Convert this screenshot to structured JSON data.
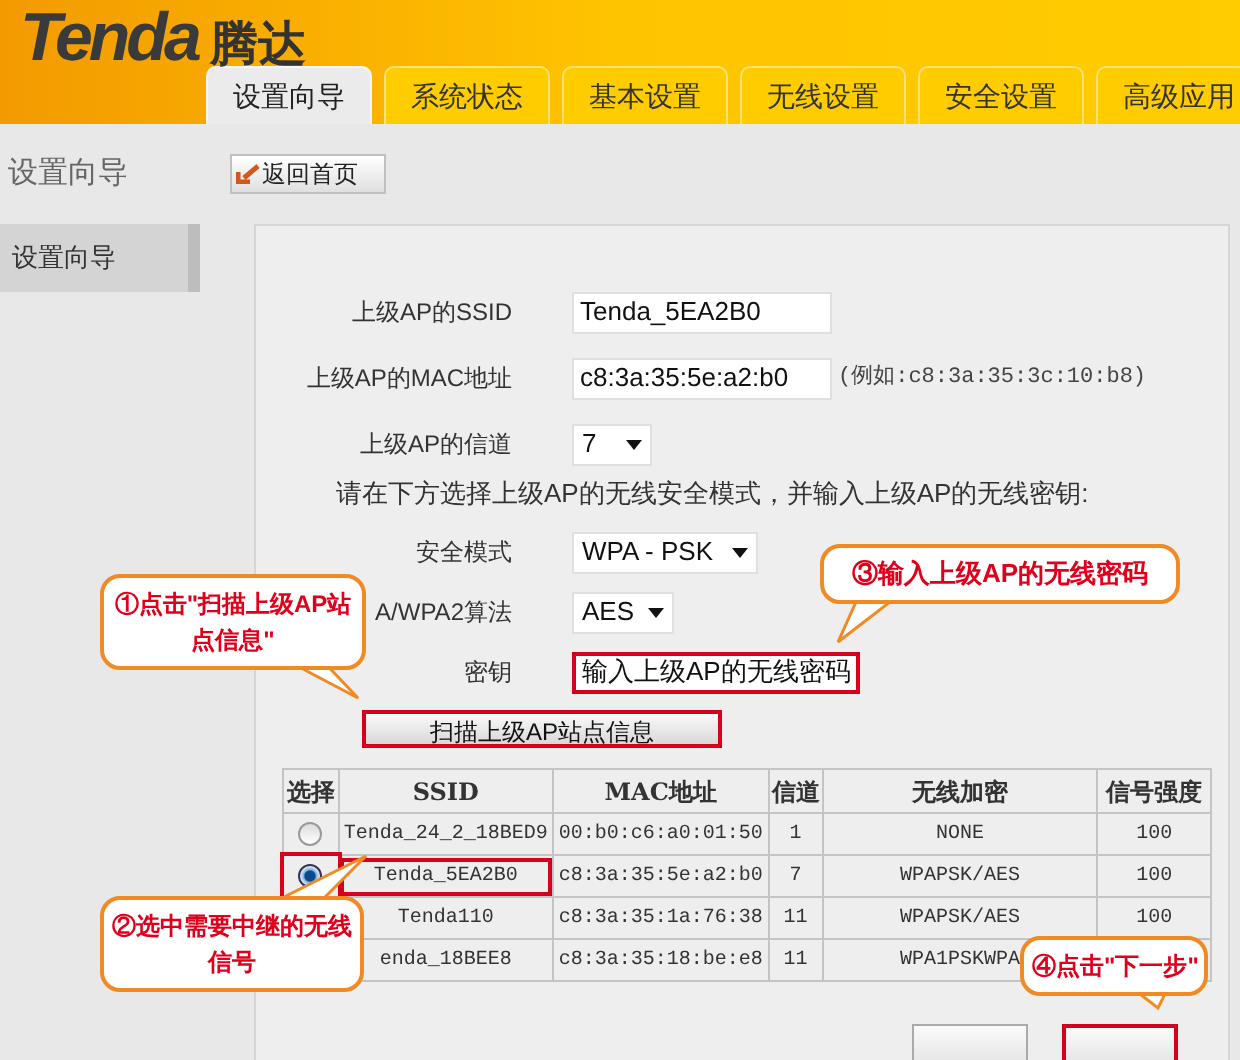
{
  "logo": {
    "wordmark": "Tenda",
    "chinese": "腾达"
  },
  "tabs": [
    {
      "label": "设置向导",
      "selected": true
    },
    {
      "label": "系统状态",
      "selected": false
    },
    {
      "label": "基本设置",
      "selected": false
    },
    {
      "label": "无线设置",
      "selected": false
    },
    {
      "label": "安全设置",
      "selected": false
    },
    {
      "label": "高级应用",
      "selected": false
    }
  ],
  "sidebar": {
    "title": "设置向导",
    "items": [
      {
        "label": "设置向导",
        "selected": true
      }
    ]
  },
  "back_button": "返回首页",
  "form": {
    "fields": [
      {
        "kind": "input",
        "label": "上级AP的SSID",
        "value": "Tenda_5EA2B0",
        "highlighted": false
      },
      {
        "kind": "input",
        "label": "上级AP的MAC地址",
        "value": "c8:3a:35:5e:a2:b0",
        "hint": "(例如:c8:3a:35:3c:10:b8)",
        "highlighted": false
      },
      {
        "kind": "select",
        "label": "上级AP的信道",
        "value": "7"
      },
      {
        "kind": "note",
        "text": "请在下方选择上级AP的无线安全模式，并输入上级AP的无线密钥:"
      },
      {
        "kind": "select",
        "label": "安全模式",
        "value": "WPA - PSK"
      },
      {
        "kind": "select",
        "label": "A/WPA2算法",
        "value": "AES"
      },
      {
        "kind": "input",
        "label": "密钥",
        "value": "输入上级AP的无线密码",
        "highlighted": true
      }
    ]
  },
  "scan_button": {
    "label": "扫描上级AP站点信息",
    "highlighted": true
  },
  "table": {
    "columns": [
      "选择",
      "SSID",
      "MAC地址",
      "信道",
      "无线加密",
      "信号强度"
    ],
    "rows": [
      {
        "selected": false,
        "ssid": "Tenda_24_2_18BED9",
        "mac": "00:b0:c6:a0:01:50",
        "channel": "1",
        "encryption": "NONE",
        "signal": "100"
      },
      {
        "selected": true,
        "highlighted": true,
        "ssid": "Tenda_5EA2B0",
        "mac": "c8:3a:35:5e:a2:b0",
        "channel": "7",
        "encryption": "WPAPSK/AES",
        "signal": "100"
      },
      {
        "ssid": "Tenda110",
        "mac": "c8:3a:35:1a:76:38",
        "channel": "11",
        "encryption": "WPAPSK/AES",
        "signal": "100"
      },
      {
        "ssid": "enda_18BEE8",
        "mac": "c8:3a:35:18:be:e8",
        "channel": "11",
        "encryption": "WPA1PSKWPA"
      }
    ]
  },
  "buttons": [
    {
      "highlighted": false
    },
    {
      "highlighted": true
    }
  ],
  "callouts": [
    {
      "text": "③输入上级AP的无线密码"
    },
    {
      "text": "①点击\"扫描上级AP站点信息\""
    },
    {
      "text": "②选中需要中继的无线信号"
    },
    {
      "text": "④点击\"下一步\""
    }
  ]
}
